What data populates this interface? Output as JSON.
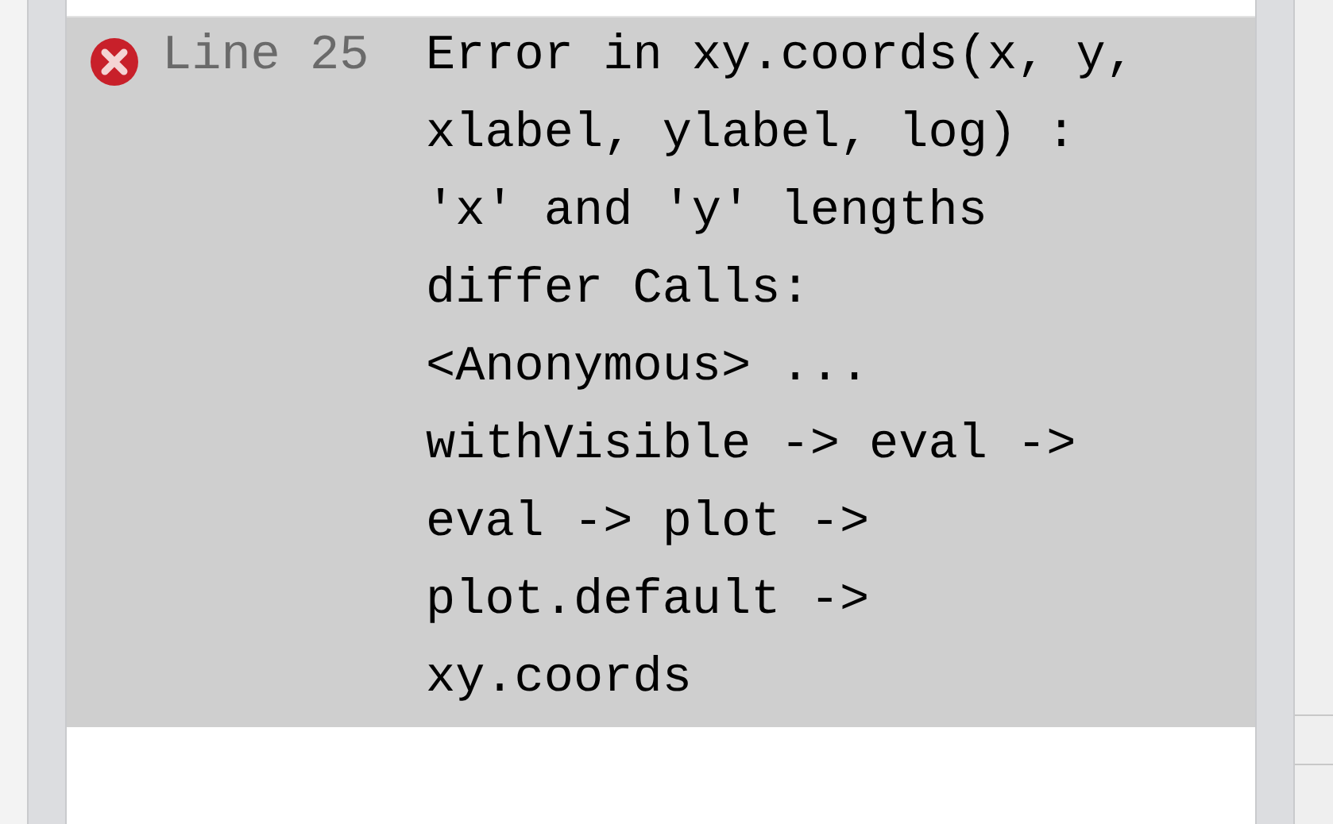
{
  "messages": [
    {
      "kind": "error",
      "line": "Line 25",
      "text": "Error in xy.coords(x, y, xlabel, ylabel, log) : 'x' and 'y' lengths differ Calls: <Anonymous> ... withVisible -> eval -> eval -> plot -> plot.default -> xy.coords"
    }
  ]
}
